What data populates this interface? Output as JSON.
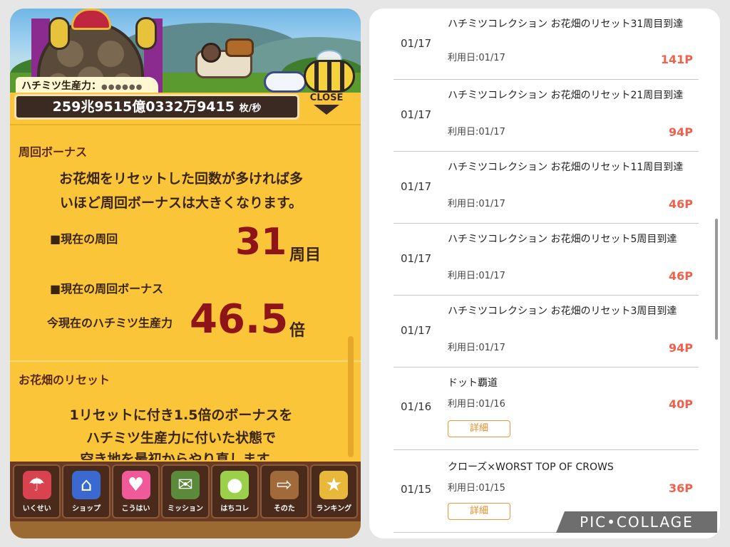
{
  "game": {
    "production_label": "ハチミツ生産力：",
    "production_rate": "259兆9515億0332万9415",
    "production_unit": "枚/秒",
    "close_label": "CLOSE",
    "lap_bonus": {
      "title": "周回ボーナス",
      "description_line1": "お花畑をリセットした回数が多ければ多",
      "description_line2": "いほど周回ボーナスは大きくなります。",
      "current_lap_label": "■現在の周回",
      "current_lap_value": "31",
      "current_lap_unit": "周目",
      "current_bonus_label": "■現在の周回ボーナス",
      "current_power_label": "今現在のハチミツ生産力",
      "current_power_value": "46.5",
      "current_power_unit": "倍"
    },
    "reset": {
      "title": "お花畑のリセット",
      "line1": "1リセットに付き1.5倍のボーナスを",
      "line2": "ハチミツ生産力に付いた状態で",
      "line3": "空き地を最初からやり直します。"
    },
    "tabs": [
      {
        "label": "いくせい",
        "icon": "watering-can-icon",
        "color": "#d9434f"
      },
      {
        "label": "ショップ",
        "icon": "shop-icon",
        "color": "#3a6ad0"
      },
      {
        "label": "こうはい",
        "icon": "heart-icon",
        "color": "#f05a9a"
      },
      {
        "label": "ミッション",
        "icon": "mission-scroll-icon",
        "color": "#5a8a3a"
      },
      {
        "label": "はちコレ",
        "icon": "bee-icon",
        "color": "#9ad04a"
      },
      {
        "label": "そのた",
        "icon": "signpost-icon",
        "color": "#a06a3a"
      },
      {
        "label": "ランキング",
        "icon": "podium-icon",
        "color": "#e8b83a"
      }
    ]
  },
  "history": {
    "items": [
      {
        "date": "01/17",
        "title": "ハチミツコレクション お花畑のリセット31周目到達",
        "used": "利用日:01/17",
        "points": "141P"
      },
      {
        "date": "01/17",
        "title": "ハチミツコレクション お花畑のリセット21周目到達",
        "used": "利用日:01/17",
        "points": "94P"
      },
      {
        "date": "01/17",
        "title": "ハチミツコレクション お花畑のリセット11周目到達",
        "used": "利用日:01/17",
        "points": "46P"
      },
      {
        "date": "01/17",
        "title": "ハチミツコレクション お花畑のリセット5周目到達",
        "used": "利用日:01/17",
        "points": "46P"
      },
      {
        "date": "01/17",
        "title": "ハチミツコレクション お花畑のリセット3周目到達",
        "used": "利用日:01/17",
        "points": "94P"
      },
      {
        "date": "01/16",
        "title": "ドット覇道",
        "used": "利用日:01/16",
        "points": "40P",
        "detail": "詳細"
      },
      {
        "date": "01/15",
        "title": "クローズ×WORST TOP OF CROWS",
        "used": "利用日:01/15",
        "points": "36P",
        "detail": "詳細"
      }
    ]
  },
  "watermark": "PIC•COLLAGE"
}
